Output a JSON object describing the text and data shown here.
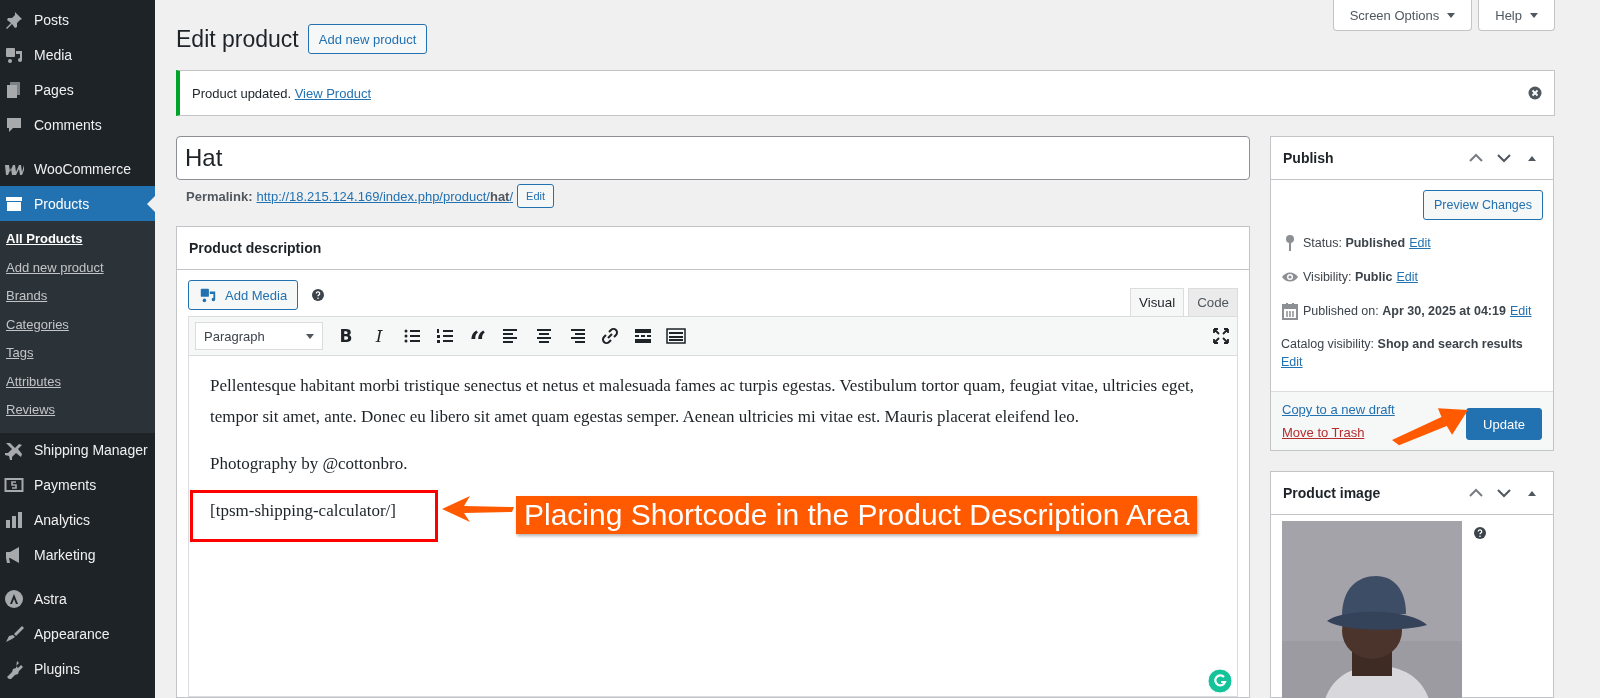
{
  "sidebar": {
    "groups": [
      [
        {
          "label": "Posts",
          "selected": false
        },
        {
          "label": "Media",
          "selected": false
        },
        {
          "label": "Pages",
          "selected": false
        },
        {
          "label": "Comments",
          "selected": false
        }
      ],
      [
        {
          "label": "WooCommerce",
          "selected": false
        },
        {
          "label": "Products",
          "selected": true,
          "children": [
            {
              "label": "All Products",
              "selected": true
            },
            {
              "label": "Add new product",
              "selected": false
            },
            {
              "label": "Brands",
              "selected": false
            },
            {
              "label": "Categories",
              "selected": false
            },
            {
              "label": "Tags",
              "selected": false
            },
            {
              "label": "Attributes",
              "selected": false
            },
            {
              "label": "Reviews",
              "selected": false
            }
          ]
        },
        {
          "label": "Shipping Manager",
          "selected": false
        },
        {
          "label": "Payments",
          "selected": false
        },
        {
          "label": "Analytics",
          "selected": false
        },
        {
          "label": "Marketing",
          "selected": false
        }
      ],
      [
        {
          "label": "Astra",
          "selected": false
        },
        {
          "label": "Appearance",
          "selected": false
        },
        {
          "label": "Plugins",
          "selected": false
        }
      ]
    ]
  },
  "screen_tabs": [
    "Screen Options",
    "Help"
  ],
  "page_title": "Edit product",
  "add_new_button": "Add new product",
  "notice": {
    "text": "Product updated.",
    "link": "View Product"
  },
  "title_field": {
    "value": "Hat"
  },
  "permalink": {
    "label": "Permalink:",
    "url": "http://18.215.124.169/index.php/product/",
    "slug": "hat",
    "url_end": "/",
    "edit_button": "Edit"
  },
  "description": {
    "title": "Product description",
    "add_media": "Add Media",
    "tabs": [
      {
        "label": "Visual",
        "selected": true
      },
      {
        "label": "Code",
        "selected": false
      }
    ],
    "format_select": "Paragraph",
    "bold": "B",
    "italic": "I",
    "quote": "“",
    "paragraphs": [
      "Pellentesque habitant morbi tristique senectus et netus et malesuada fames ac turpis egestas. Vestibulum tortor quam, feugiat vitae, ultricies eget, tempor sit amet, ante. Donec eu libero sit amet quam egestas semper. Aenean ultricies mi vitae est. Mauris placerat eleifend leo.",
      "Photography by @cottonbro.",
      "[tpsm-shipping-calculator/]"
    ]
  },
  "callout": {
    "text": "Placing Shortcode in the Product Description Area"
  },
  "publish": {
    "title": "Publish",
    "preview_button": "Preview Changes",
    "rows": [
      {
        "label": "Status:",
        "value": "Published",
        "link": "Edit"
      },
      {
        "label": "Visibility:",
        "value": "Public",
        "link": "Edit"
      },
      {
        "label": "Published on:",
        "value": "Apr 30, 2025 at 04:19",
        "link": "Edit"
      },
      {
        "label": "Catalog visibility:",
        "value": "Shop and search results",
        "link": "Edit"
      }
    ],
    "copy_link": "Copy to a new draft",
    "trash_link": "Move to Trash",
    "update_button": "Update"
  },
  "product_image": {
    "title": "Product image"
  }
}
